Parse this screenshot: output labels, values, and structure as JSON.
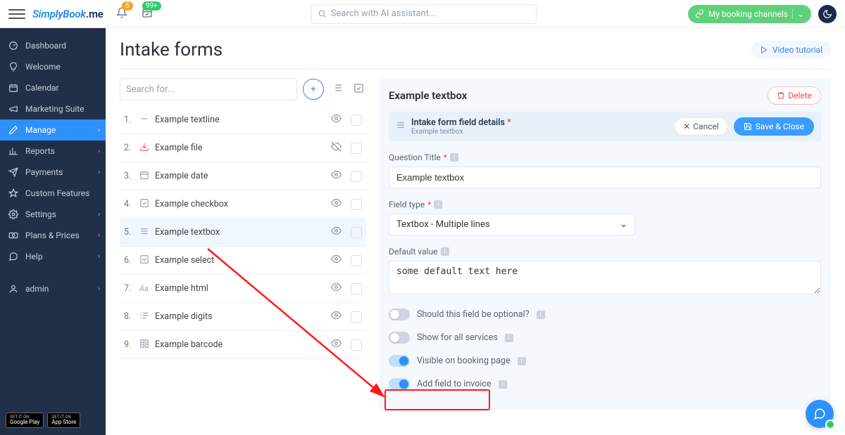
{
  "top": {
    "logo_simplybook": "SimplyBook",
    "logo_me": ".me",
    "bell_badge": "5",
    "cal_badge": "99+",
    "search_placeholder": "Search with AI assistant...",
    "booking_btn": "My booking channels"
  },
  "sidebar": {
    "items": [
      {
        "label": "Dashboard"
      },
      {
        "label": "Welcome"
      },
      {
        "label": "Calendar"
      },
      {
        "label": "Marketing Suite"
      },
      {
        "label": "Manage"
      },
      {
        "label": "Reports"
      },
      {
        "label": "Payments"
      },
      {
        "label": "Custom Features"
      },
      {
        "label": "Settings"
      },
      {
        "label": "Plans & Prices"
      },
      {
        "label": "Help"
      },
      {
        "label": "admin"
      }
    ],
    "store_google_top": "GET IT ON",
    "store_google": "Google Play",
    "store_apple_top": "GET IT ON",
    "store_apple": "App Store"
  },
  "page": {
    "title": "Intake forms",
    "video_btn": "Video tutorial"
  },
  "list": {
    "search_placeholder": "Search for...",
    "items": [
      {
        "n": "1.",
        "label": "Example textline",
        "visible": true
      },
      {
        "n": "2.",
        "label": "Example file",
        "visible": false
      },
      {
        "n": "3.",
        "label": "Example date",
        "visible": true
      },
      {
        "n": "4.",
        "label": "Example checkbox",
        "visible": true
      },
      {
        "n": "5.",
        "label": "Example textbox",
        "visible": true
      },
      {
        "n": "6.",
        "label": "Example select",
        "visible": true
      },
      {
        "n": "7.",
        "label": "Example html",
        "visible": true
      },
      {
        "n": "8.",
        "label": "Example digits",
        "visible": true
      },
      {
        "n": "9.",
        "label": "Example barcode",
        "visible": true
      }
    ]
  },
  "detail": {
    "header_title": "Example textbox",
    "delete": "Delete",
    "sub_title": "Intake form field details",
    "sub_sub": "Example textbox",
    "cancel": "Cancel",
    "save": "Save & Close",
    "q_title_label": "Question Title",
    "q_title_value": "Example textbox",
    "field_type_label": "Field type",
    "field_type_value": "Textbox - Multiple lines",
    "default_label": "Default value",
    "default_value": "some default text here",
    "toggle_optional": "Should this field be optional?",
    "toggle_all_services": "Show for all services",
    "toggle_visible": "Visible on booking page",
    "toggle_invoice": "Add field to invoice"
  }
}
